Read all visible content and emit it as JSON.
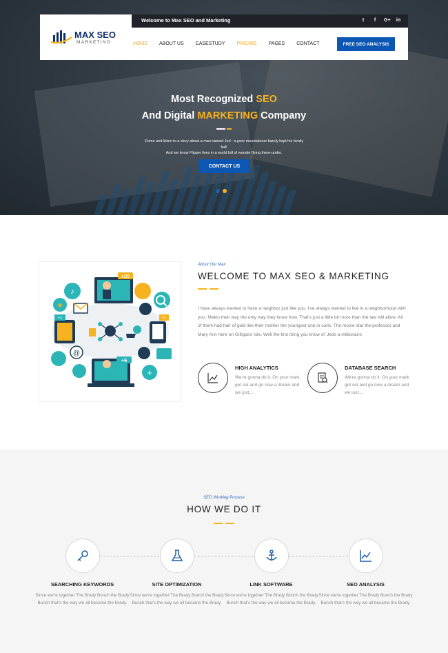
{
  "topbar": {
    "welcome": "Welcome to Max SEO and Marketing",
    "social": [
      "t",
      "f",
      "G+",
      "in"
    ]
  },
  "logo": {
    "line1": "MAX SEO",
    "line2": "MARKETING"
  },
  "nav": {
    "items": [
      "HOME",
      "ABOUT US",
      "CASESTUDY",
      "PRICING",
      "PAGES",
      "CONTACT"
    ],
    "active": "HOME",
    "cta": "FREE SEO ANALYSIS"
  },
  "hero": {
    "title_line1_a": "Most Recognized",
    "title_line1_b": "SEO",
    "title_line2_a": "And Digital",
    "title_line2_b": "MARKETING",
    "title_line2_c": "Company",
    "text_line1": "Come and listen to a story about a man named Jed - a poor mountaineer barely kept his family fed!",
    "text_line2": "And we know Flipper lives in a world full of wonder flying there-under.",
    "button": "CONTACT US",
    "slides": 2,
    "active_slide": 2
  },
  "about": {
    "small": "About Our Max",
    "title": "WELCOME TO MAX SEO & MARKETING",
    "paragraph": "I have always wanted to have a neighbor just like you. I've always wanted to live in a neighborhood with you. Makin their way the only way they know how. That's just a little bit more than the law will allow. All of them had hair of gold like their mother the youngest one in curls. The movie star the professor and Mary Ann here on Gilligans Isle. Well the first thing you know ol' Jeds a millionaire.",
    "features": [
      {
        "title": "HIGH ANALYTICS",
        "desc": "We're gonna do it. On your mark get set and go now a dream and we just....",
        "icon": "chart-icon"
      },
      {
        "title": "DATABASE SEARCH",
        "desc": "We're gonna do it. On your mark get set and go now a dream and we just....",
        "icon": "document-search-icon"
      }
    ],
    "illustration_badges": [
      "+20",
      "+1",
      "+6",
      "+1"
    ]
  },
  "how": {
    "small": "SEO Working Process",
    "title": "HOW WE DO IT",
    "steps": [
      {
        "title": "SEARCHING KEYWORDS",
        "desc": "Since we're together The Brady Bunch the Brady Bunch that's the way we all became the Brady.",
        "icon": "key-icon"
      },
      {
        "title": "SITE OPTIMIZATION",
        "desc": "Since we're together The Brady Bunch the Brady Bunch that's the way we all became the Brady.",
        "icon": "flask-icon"
      },
      {
        "title": "LINK SOFTWARE",
        "desc": "Since we're together The Brady Bunch the Brady Bunch that's the way we all became the Brady.",
        "icon": "anchor-icon"
      },
      {
        "title": "SEO ANALYSIS",
        "desc": "Since we're together The Brady Bunch the Brady Bunch that's the way we all became the Brady.",
        "icon": "chart-icon"
      }
    ]
  },
  "colors": {
    "accent": "#f7b220",
    "primary": "#0d57b4",
    "dark": "#1f2329",
    "text_blue": "#2c6ab8"
  }
}
